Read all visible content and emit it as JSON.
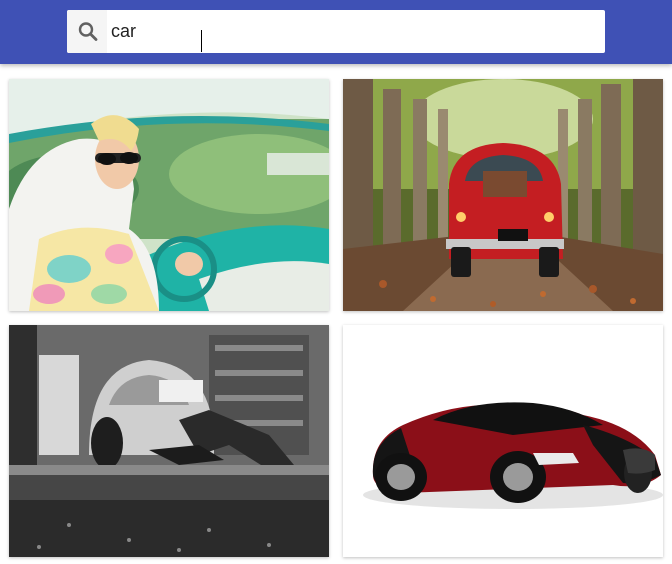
{
  "search": {
    "value": "car",
    "icon": "search-icon"
  },
  "results": [
    {
      "name": "image-woman-in-vintage-car"
    },
    {
      "name": "image-red-fiat-on-forest-road"
    },
    {
      "name": "image-mechanic-under-beetle"
    },
    {
      "name": "image-red-black-supercar"
    }
  ],
  "colors": {
    "appbar": "#3f51b5",
    "search_bg": "#ffffff",
    "accent_red": "#c0161f"
  }
}
